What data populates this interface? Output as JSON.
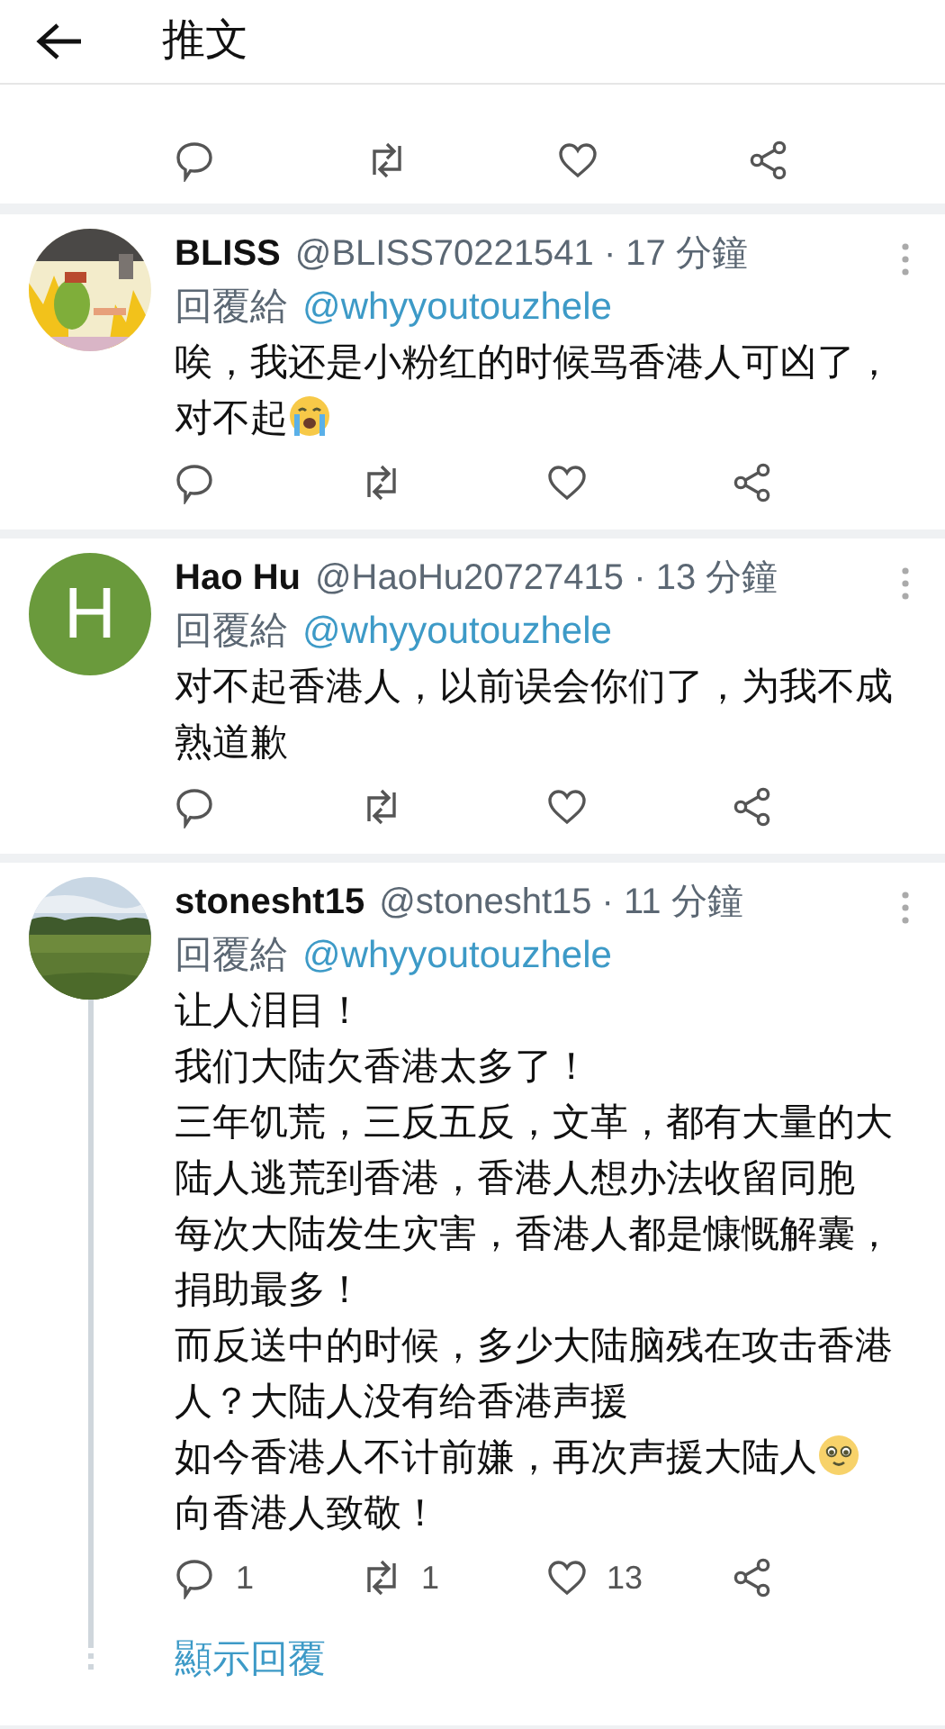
{
  "header": {
    "title": "推文"
  },
  "tweets": [
    {
      "kind": "cut_off",
      "actions": [
        {
          "kind": "reply"
        },
        {
          "kind": "retweet"
        },
        {
          "kind": "like"
        },
        {
          "kind": "share"
        }
      ]
    },
    {
      "kind": "reply",
      "name": "BLISS",
      "meta": "@BLISS70221541 · 17 分鐘",
      "reply_label": "回覆給",
      "reply_to": "@whyyoutouzhele",
      "lines": [
        {
          "text": "唉，我还是小粉红的时候骂香港人可凶了，"
        },
        {
          "text": "对不起",
          "emoji": {
            "kind": "crying"
          }
        }
      ],
      "actions": [
        {
          "kind": "reply"
        },
        {
          "kind": "retweet"
        },
        {
          "kind": "like"
        },
        {
          "kind": "share"
        }
      ]
    },
    {
      "kind": "reply",
      "avatar": {
        "kind": "letter",
        "letter": "H",
        "color": "#6a9a3c"
      },
      "name": "Hao Hu",
      "meta": "@HaoHu20727415 · 13 分鐘",
      "reply_label": "回覆給",
      "reply_to": "@whyyoutouzhele",
      "lines": [
        {
          "text": "对不起香港人，以前误会你们了，为我不成熟道歉"
        }
      ],
      "actions": [
        {
          "kind": "reply"
        },
        {
          "kind": "retweet"
        },
        {
          "kind": "like"
        },
        {
          "kind": "share"
        }
      ]
    },
    {
      "kind": "reply",
      "name": "stonesht15",
      "meta": "@stonesht15 · 11 分鐘",
      "reply_label": "回覆給",
      "reply_to": "@whyyoutouzhele",
      "lines": [
        {
          "text": "让人泪目！"
        },
        {
          "text": "我们大陆欠香港太多了！"
        },
        {
          "text": "三年饥荒，三反五反，文革，都有大量的大陆人逃荒到香港，香港人想办法收留同胞"
        },
        {
          "text": "每次大陆发生灾害，香港人都是慷慨解囊，捐助最多！"
        },
        {
          "text": "而反送中的时候，多少大陆脑残在攻击香港人？大陆人没有给香港声援"
        },
        {
          "text": "如今香港人不计前嫌，再次声援大陆人",
          "emoji": {
            "kind": "teary"
          }
        },
        {
          "text": "向香港人致敬！"
        }
      ],
      "thread_line": true,
      "show_replies": "顯示回覆",
      "actions": [
        {
          "kind": "reply",
          "count": "1"
        },
        {
          "kind": "retweet",
          "count": "1"
        },
        {
          "kind": "like",
          "count": "13"
        },
        {
          "kind": "share"
        }
      ]
    }
  ]
}
